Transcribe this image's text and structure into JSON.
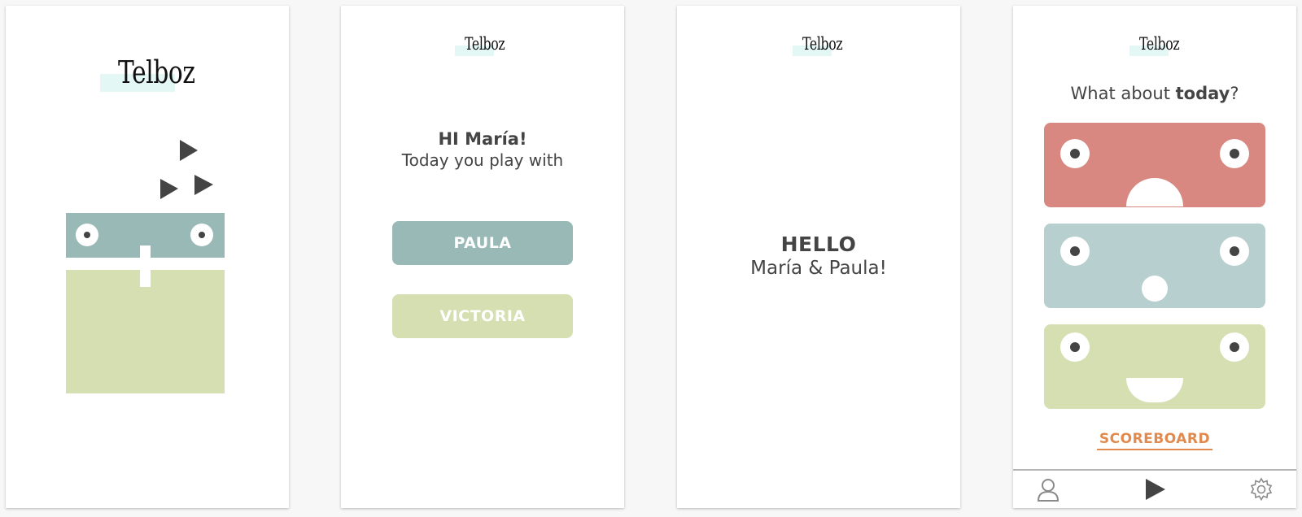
{
  "app": {
    "logo_text": "Telboz"
  },
  "screen2": {
    "greeting": "HI María!",
    "subtitle": "Today you play with",
    "players": [
      "PAULA",
      "VICTORIA"
    ]
  },
  "screen3": {
    "title": "HELLO",
    "subtitle": "María & Paula!"
  },
  "screen4": {
    "question_prefix": "What about ",
    "question_bold": "today",
    "question_suffix": "?",
    "moods": [
      "sad",
      "surprised",
      "happy"
    ],
    "scoreboard_label": "SCOREBOARD",
    "tabs": [
      "profile-icon",
      "play-icon",
      "settings-icon"
    ]
  },
  "colors": {
    "teal": "#99b9b6",
    "green": "#d5dfb2",
    "red": "#d88880",
    "light_teal": "#b7cfce",
    "orange": "#e08a4e",
    "dark": "#444444",
    "logo_highlight": "#e3f7f5"
  }
}
